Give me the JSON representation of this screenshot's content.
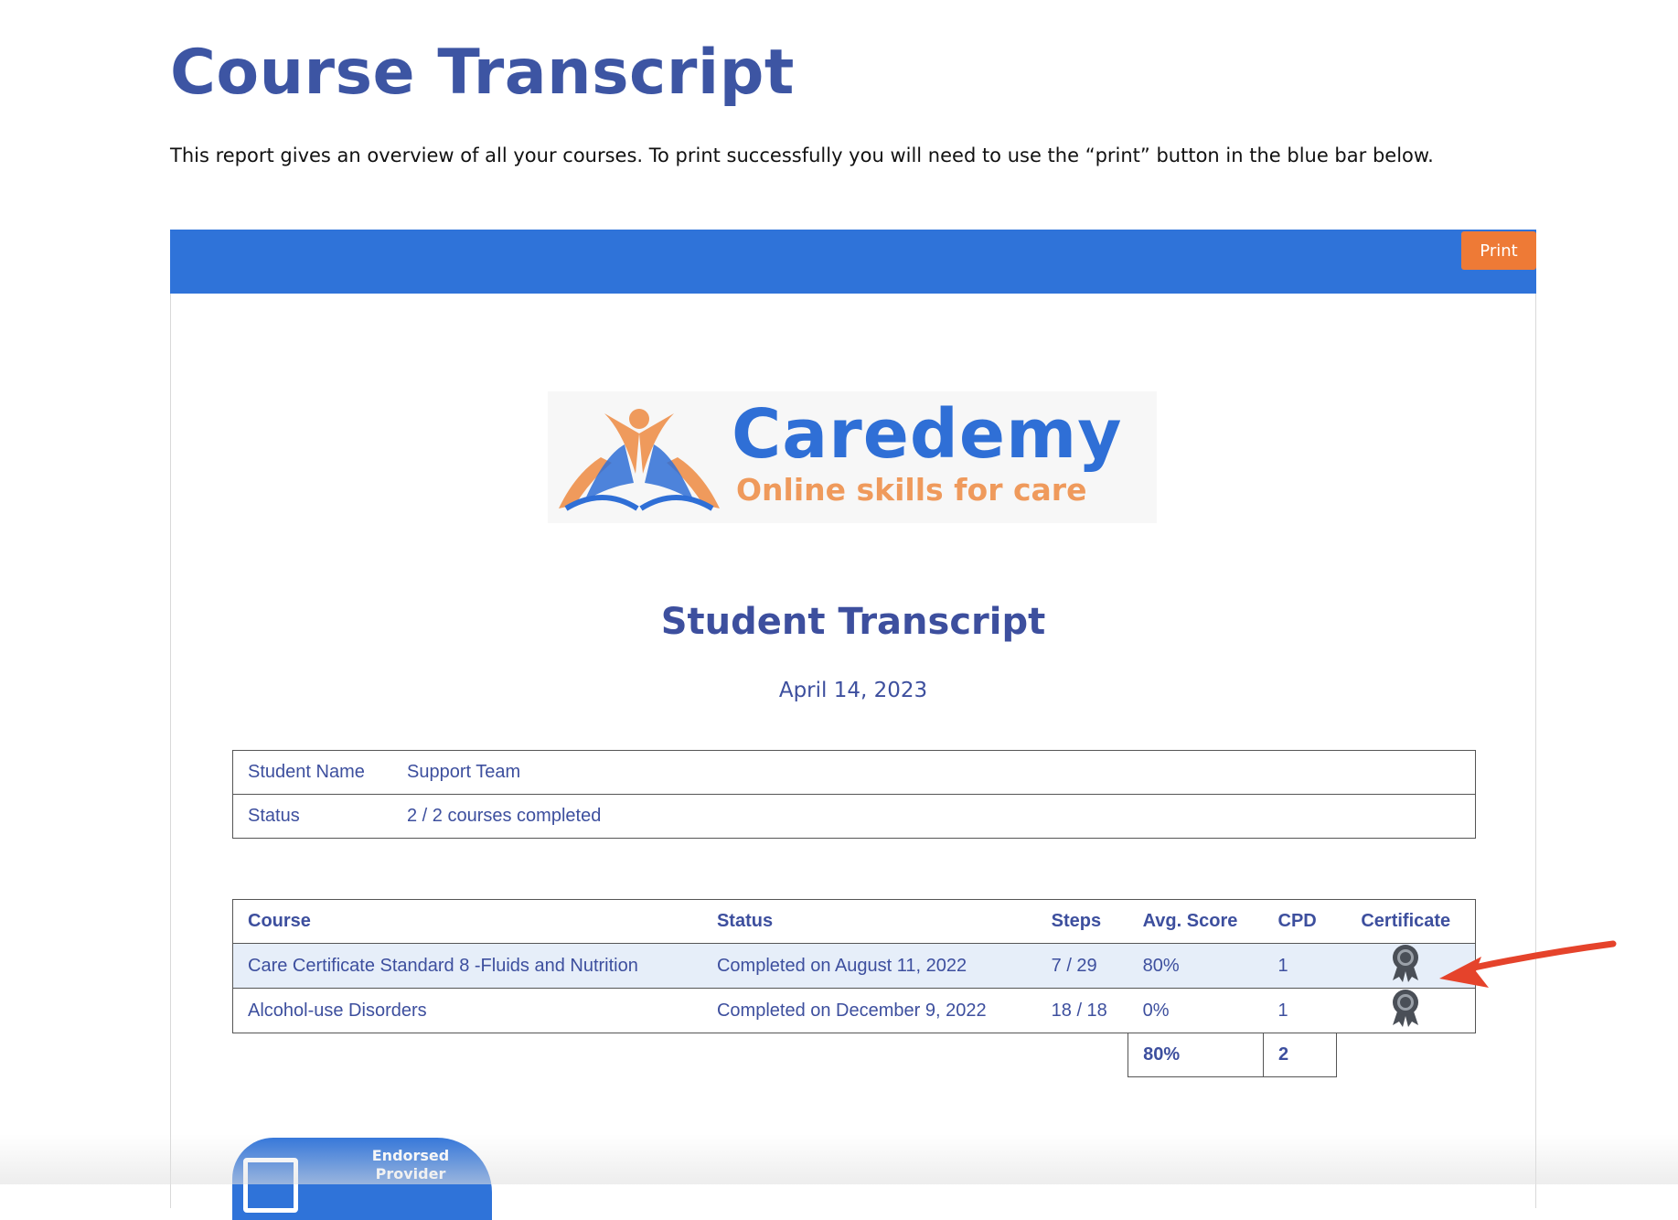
{
  "header": {
    "title": "Course Transcript",
    "intro": "This report gives an overview of all your courses. To print successfully you will need to use the “print” button in the blue bar below."
  },
  "toolbar": {
    "print_label": "Print",
    "bar_color": "#2f73d9",
    "print_color": "#ee7a36"
  },
  "logo": {
    "name": "Caredemy",
    "tagline": "Online skills for care"
  },
  "report": {
    "title": "Student Transcript",
    "date": "April 14, 2023"
  },
  "student": {
    "name_label": "Student Name",
    "name_value": "Support Team",
    "status_label": "Status",
    "status_value": "2 / 2 courses completed"
  },
  "courses": {
    "headers": {
      "course": "Course",
      "status": "Status",
      "steps": "Steps",
      "avg_score": "Avg. Score",
      "cpd": "CPD",
      "certificate": "Certificate"
    },
    "rows": [
      {
        "course": "Care Certificate Standard 8 -Fluids and Nutrition",
        "status": "Completed on August 11, 2022",
        "steps": "7 / 29",
        "avg_score": "80%",
        "cpd": "1",
        "certificate_icon": "certificate-ribbon-icon"
      },
      {
        "course": "Alcohol-use Disorders",
        "status": "Completed on December 9, 2022",
        "steps": "18 / 18",
        "avg_score": "0%",
        "cpd": "1",
        "certificate_icon": "certificate-ribbon-icon"
      }
    ],
    "totals": {
      "avg_score": "80%",
      "cpd": "2"
    }
  },
  "badge": {
    "line1": "Endorsed",
    "line2": "Provider"
  }
}
